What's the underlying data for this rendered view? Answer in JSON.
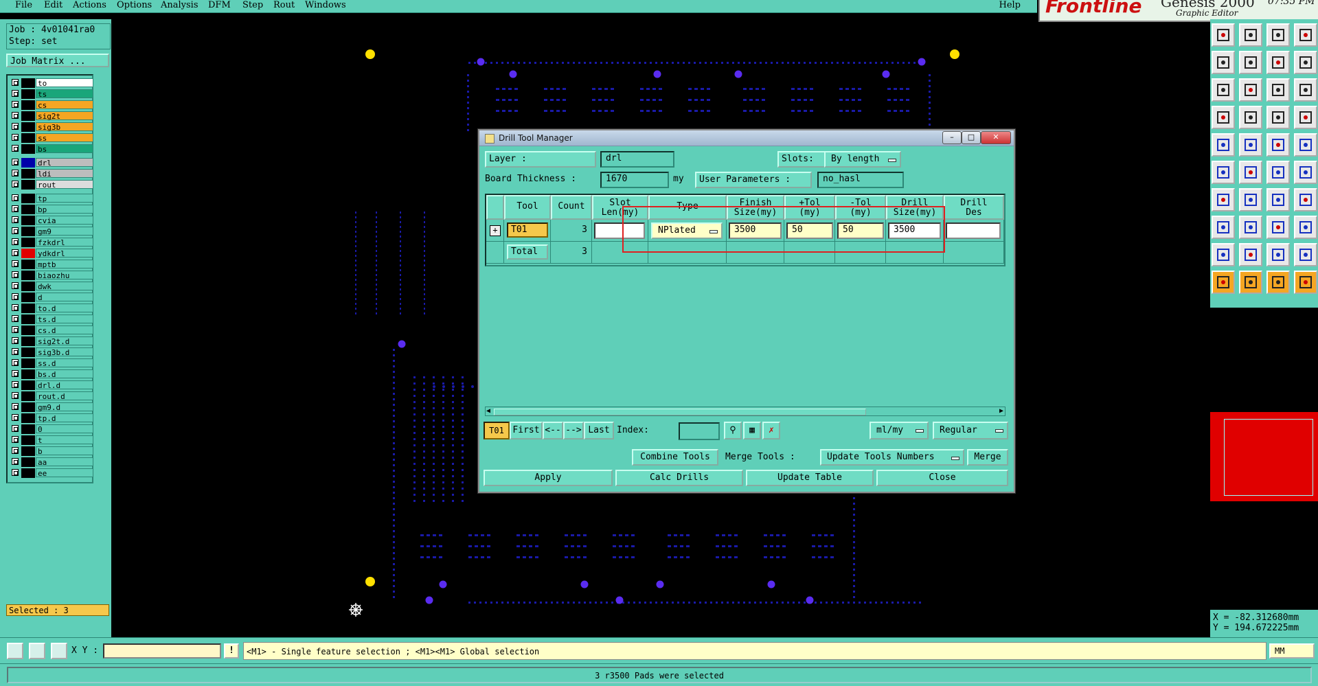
{
  "menubar": {
    "items": [
      "File",
      "Edit",
      "Actions",
      "Options",
      "Analysis",
      "DFM",
      "Step",
      "Rout",
      "Windows"
    ],
    "help": "Help"
  },
  "brand": {
    "logo": "Frontline",
    "product": "Genesis 2000",
    "subtitle": "Graphic Editor",
    "clock": "07:35 PM"
  },
  "job": {
    "job_line": "Job : 4v01041ra0",
    "step_line": "Step: set",
    "matrix_button": "Job Matrix ..."
  },
  "layers": [
    {
      "name": "to",
      "color": "#ffffff",
      "ind": "#000000"
    },
    {
      "name": "ts",
      "color": "#1aa67a",
      "ind": "#000000"
    },
    {
      "name": "cs",
      "color": "#f5a623",
      "ind": "#000000"
    },
    {
      "name": "sig2t",
      "color": "#f5a623",
      "ind": "#000000"
    },
    {
      "name": "sig3b",
      "color": "#f5a623",
      "ind": "#000000"
    },
    {
      "name": "ss",
      "color": "#f5a623",
      "ind": "#000000"
    },
    {
      "name": "bs",
      "color": "#1aa67a",
      "ind": "#000000"
    },
    {
      "name": "drl",
      "color": "#bdbdbd",
      "ind": "#0000aa",
      "gap": true
    },
    {
      "name": "ldi",
      "color": "#bdbdbd",
      "ind": "#000000"
    },
    {
      "name": "rout",
      "color": "#dcdcdc",
      "ind": "#000000"
    },
    {
      "name": "tp",
      "color": "#5fcfb8",
      "ind": "#000000",
      "gap": true
    },
    {
      "name": "bp",
      "color": "#5fcfb8",
      "ind": "#000000"
    },
    {
      "name": "cvia",
      "color": "#5fcfb8",
      "ind": "#000000"
    },
    {
      "name": "gm9",
      "color": "#5fcfb8",
      "ind": "#000000"
    },
    {
      "name": "fzkdrl",
      "color": "#5fcfb8",
      "ind": "#000000"
    },
    {
      "name": "ydkdrl",
      "color": "#5fcfb8",
      "ind": "#e00000"
    },
    {
      "name": "mptb",
      "color": "#5fcfb8",
      "ind": "#000000"
    },
    {
      "name": "biaozhu",
      "color": "#5fcfb8",
      "ind": "#000000"
    },
    {
      "name": "dwk",
      "color": "#5fcfb8",
      "ind": "#000000"
    },
    {
      "name": "d",
      "color": "#5fcfb8",
      "ind": "#000000"
    },
    {
      "name": "to.d",
      "color": "#5fcfb8",
      "ind": "#000000"
    },
    {
      "name": "ts.d",
      "color": "#5fcfb8",
      "ind": "#000000"
    },
    {
      "name": "cs.d",
      "color": "#5fcfb8",
      "ind": "#000000"
    },
    {
      "name": "sig2t.d",
      "color": "#5fcfb8",
      "ind": "#000000"
    },
    {
      "name": "sig3b.d",
      "color": "#5fcfb8",
      "ind": "#000000"
    },
    {
      "name": "ss.d",
      "color": "#5fcfb8",
      "ind": "#000000"
    },
    {
      "name": "bs.d",
      "color": "#5fcfb8",
      "ind": "#000000"
    },
    {
      "name": "drl.d",
      "color": "#5fcfb8",
      "ind": "#000000"
    },
    {
      "name": "rout.d",
      "color": "#5fcfb8",
      "ind": "#000000"
    },
    {
      "name": "gm9.d",
      "color": "#5fcfb8",
      "ind": "#000000"
    },
    {
      "name": "tp.d",
      "color": "#5fcfb8",
      "ind": "#000000"
    },
    {
      "name": "0",
      "color": "#5fcfb8",
      "ind": "#000000"
    },
    {
      "name": "t",
      "color": "#5fcfb8",
      "ind": "#000000"
    },
    {
      "name": "b",
      "color": "#5fcfb8",
      "ind": "#000000"
    },
    {
      "name": "aa",
      "color": "#5fcfb8",
      "ind": "#000000"
    },
    {
      "name": "ee",
      "color": "#5fcfb8",
      "ind": "#000000"
    }
  ],
  "selected": "Selected : 3",
  "dialog": {
    "title": "Drill Tool Manager",
    "layer_label": "Layer          :",
    "layer_value": "drl",
    "slots_label": "Slots:",
    "slots_value": "By length",
    "thickness_label": "Board Thickness :",
    "thickness_value": "1670",
    "thickness_unit": "my",
    "user_params_label": "User Parameters :",
    "user_params_value": "no_hasl",
    "headers": {
      "tool": "Tool",
      "count": "Count",
      "slot_len_1": "Slot",
      "slot_len_2": "Len(my)",
      "type": "Type",
      "finish_1": "Finish",
      "finish_2": "Size(my)",
      "ptol_1": "+Tol",
      "ptol_2": "(my)",
      "mtol_1": "-Tol",
      "mtol_2": "(my)",
      "drill_1": "Drill",
      "drill_2": "Size(my)",
      "des_1": "Drill",
      "des_2": "Des"
    },
    "row": {
      "tool": "T01",
      "count": "3",
      "slot_len": "",
      "type": "NPlated",
      "finish": "3500",
      "ptol": "50",
      "mtol": "50",
      "drill": "3500",
      "des": ""
    },
    "total": {
      "label": "Total",
      "count": "3"
    },
    "nav": {
      "current": "T01",
      "first": "First",
      "prev": "<--",
      "next": "-->",
      "last": "Last",
      "index_label": "Index:",
      "units": "ml/my",
      "mode": "Regular"
    },
    "actions": {
      "combine": "Combine Tools",
      "merge_tools": "Merge Tools :",
      "update_numbers": "Update Tools Numbers",
      "merge": "Merge",
      "apply": "Apply",
      "calc": "Calc Drills",
      "update_table": "Update Table",
      "close": "Close"
    }
  },
  "coords": {
    "x": "X = -82.312680mm",
    "y": "Y = 194.672225mm"
  },
  "cmd": {
    "xy_label": "X Y :",
    "hint": "<M1> - Single feature selection ; <M1><M1> Global selection",
    "unit": "MM"
  },
  "status": "3 r3500 Pads were selected"
}
